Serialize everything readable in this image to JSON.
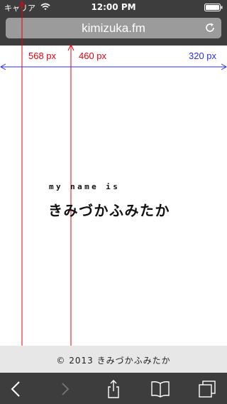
{
  "status_bar": {
    "carrier": "キャリア",
    "time": "12:00 PM"
  },
  "address_bar": {
    "url": "kimizuka.fm"
  },
  "annotations": {
    "height_568": "568 px",
    "height_460": "460 px",
    "width_320": "320 px"
  },
  "content": {
    "intro": "my name is",
    "name": "きみづかふみたか"
  },
  "footer": {
    "copyright": "© 2013 きみづかふみたか"
  },
  "colors": {
    "bar_bg": "#3d3d3d",
    "url_field_bg": "#9b9b9b",
    "footer_bg": "#e7e7e7",
    "annotation_red": "#e8000b",
    "annotation_blue": "#2a2ef0"
  }
}
